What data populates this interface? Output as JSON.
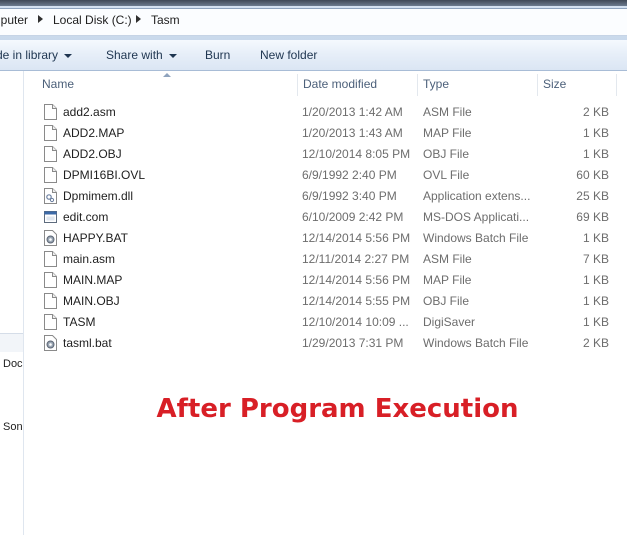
{
  "breadcrumb": [
    "nputer",
    "Local Disk (C:)",
    "Tasm"
  ],
  "toolbar": {
    "include_label": "de in library",
    "share_label": "Share with",
    "burn_label": "Burn",
    "new_folder_label": "New folder"
  },
  "nav": {
    "item1": "Doc",
    "item2": "Son"
  },
  "columns": {
    "name": "Name",
    "date": "Date modified",
    "type": "Type",
    "size": "Size"
  },
  "files": [
    {
      "name": "add2.asm",
      "date": "1/20/2013 1:42 AM",
      "type": "ASM File",
      "size": "2 KB",
      "icon": "doc-icon"
    },
    {
      "name": "ADD2.MAP",
      "date": "1/20/2013 1:43 AM",
      "type": "MAP File",
      "size": "1 KB",
      "icon": "doc-icon"
    },
    {
      "name": "ADD2.OBJ",
      "date": "12/10/2014 8:05 PM",
      "type": "OBJ File",
      "size": "1 KB",
      "icon": "doc-icon"
    },
    {
      "name": "DPMI16BI.OVL",
      "date": "6/9/1992 2:40 PM",
      "type": "OVL File",
      "size": "60 KB",
      "icon": "doc-icon"
    },
    {
      "name": "Dpmimem.dll",
      "date": "6/9/1992 3:40 PM",
      "type": "Application extens...",
      "size": "25 KB",
      "icon": "dll-icon"
    },
    {
      "name": "edit.com",
      "date": "6/10/2009 2:42 PM",
      "type": "MS-DOS Applicati...",
      "size": "69 KB",
      "icon": "app-icon"
    },
    {
      "name": "HAPPY.BAT",
      "date": "12/14/2014 5:56 PM",
      "type": "Windows Batch File",
      "size": "1 KB",
      "icon": "batch-icon"
    },
    {
      "name": "main.asm",
      "date": "12/11/2014 2:27 PM",
      "type": "ASM File",
      "size": "7 KB",
      "icon": "doc-icon"
    },
    {
      "name": "MAIN.MAP",
      "date": "12/14/2014 5:56 PM",
      "type": "MAP File",
      "size": "1 KB",
      "icon": "doc-icon"
    },
    {
      "name": "MAIN.OBJ",
      "date": "12/14/2014 5:55 PM",
      "type": "OBJ File",
      "size": "1 KB",
      "icon": "doc-icon"
    },
    {
      "name": "TASM",
      "date": "12/10/2014 10:09 ...",
      "type": "DigiSaver",
      "size": "1 KB",
      "icon": "doc-icon"
    },
    {
      "name": "tasml.bat",
      "date": "1/29/2013 7:31 PM",
      "type": "Windows Batch File",
      "size": "2 KB",
      "icon": "batch-icon"
    }
  ],
  "caption": "After Program Execution",
  "colors": {
    "caption": "#d81f26",
    "header_text": "#4c607a",
    "toolbar_text": "#1e3550"
  }
}
